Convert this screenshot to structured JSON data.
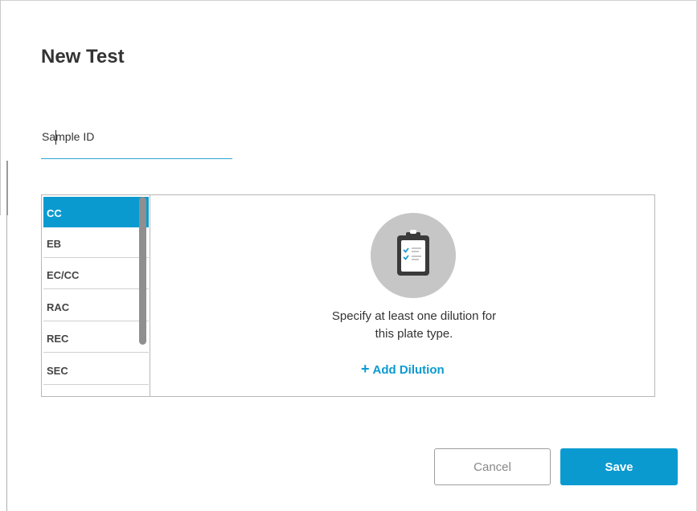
{
  "dialog": {
    "title": "New Test"
  },
  "sample_field": {
    "label": "Sample ID",
    "value": ""
  },
  "plate_types": {
    "items": [
      {
        "label": "CC",
        "selected": true
      },
      {
        "label": "EB",
        "selected": false
      },
      {
        "label": "EC/CC",
        "selected": false
      },
      {
        "label": "RAC",
        "selected": false
      },
      {
        "label": "REC",
        "selected": false
      },
      {
        "label": "SEC",
        "selected": false
      }
    ]
  },
  "empty_state": {
    "icon": "clipboard-checklist-icon",
    "message_line1": "Specify at least one dilution for",
    "message_line2": "this plate type.",
    "add_label": "Add Dilution",
    "add_icon": "plus-icon"
  },
  "actions": {
    "cancel_label": "Cancel",
    "save_label": "Save"
  },
  "colors": {
    "accent": "#0a9ad0",
    "icon_circle": "#c6c6c6"
  }
}
